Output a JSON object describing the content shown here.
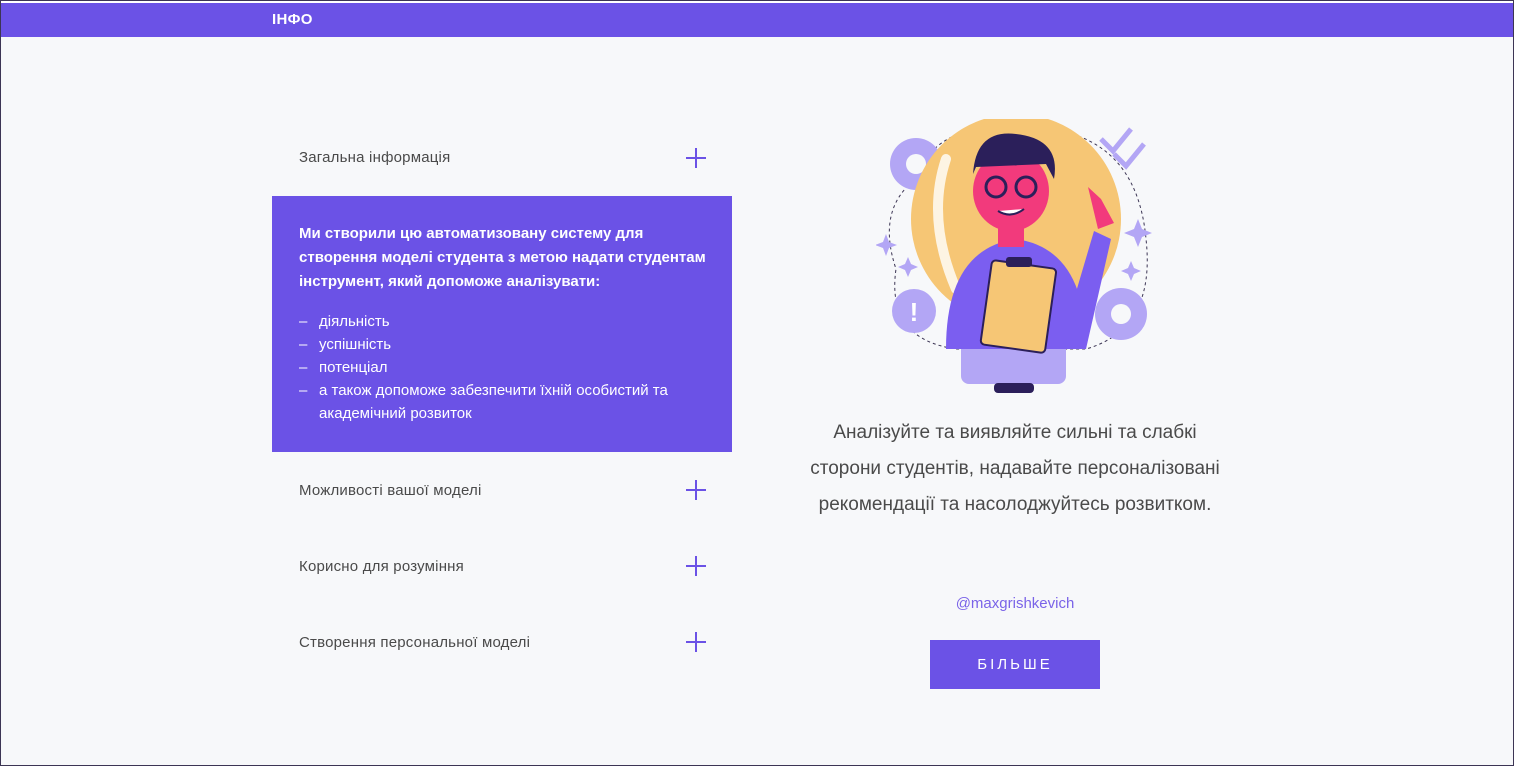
{
  "header": {
    "brand": "ІНФО"
  },
  "accordion": {
    "items": [
      {
        "label": "Загальна інформація"
      },
      {
        "label": "Можливості вашої моделі"
      },
      {
        "label": "Корисно для розуміння"
      },
      {
        "label": "Створення персональної моделі"
      }
    ],
    "panel": {
      "intro": "Ми створили цю автоматизовану систему для створення моделі студента з метою надати студентам інструмент, який допоможе аналізувати:",
      "bullets": [
        "діяльність",
        "успішність",
        "потенціал",
        "а також допоможе забезпечити їхній особистий та академічний розвиток"
      ]
    }
  },
  "promo": {
    "tagline": "Аналізуйте та виявляйте сильні та слабкі сторони студентів, надавайте персоналізовані рекомендації та насолоджуйтесь розвитком.",
    "handle": "@maxgrishkevich",
    "button_label": "БІЛЬШЕ"
  },
  "colors": {
    "accent": "#6b52e6",
    "background": "#f7f8fa"
  }
}
